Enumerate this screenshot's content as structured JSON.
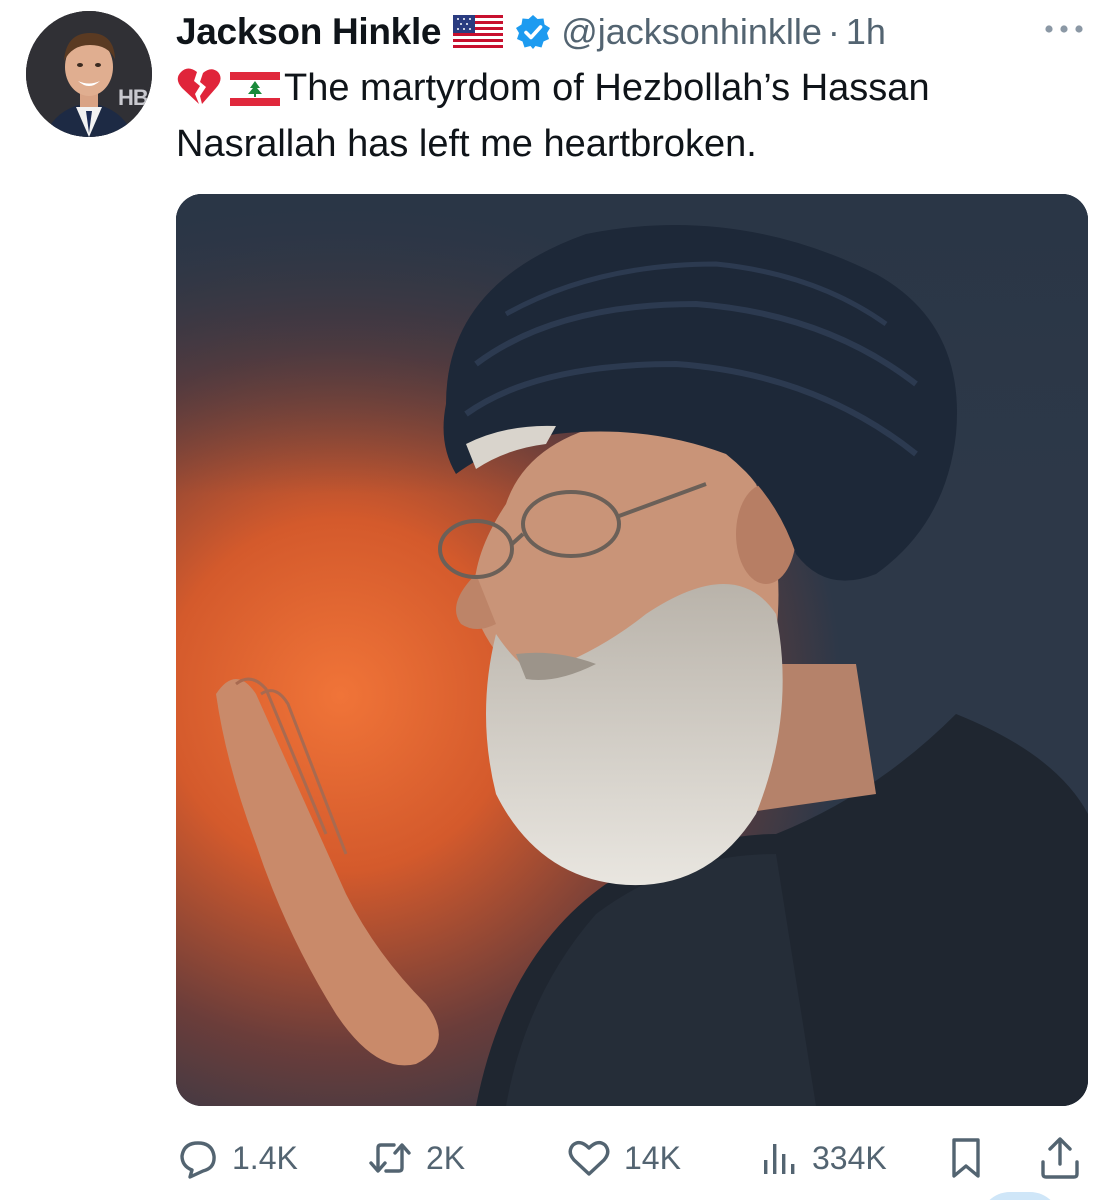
{
  "author": {
    "display_name": "Jackson Hinkle",
    "handle": "@jacksonhinklle",
    "separator": "·",
    "time": "1h",
    "avatar_badge_text": "HB"
  },
  "icons": {
    "name_flag": "us-flag-icon",
    "verified": "verified-badge-icon",
    "more": "more-options-icon",
    "emoji_1": "broken-heart-emoji",
    "emoji_2": "lebanon-flag-emoji",
    "reply": "reply-icon",
    "retweet": "retweet-icon",
    "like": "like-icon",
    "views": "views-icon",
    "bookmark": "bookmark-icon",
    "share": "share-icon"
  },
  "tweet": {
    "text_line_1": "The martyrdom of Hezbollah’s Hassan",
    "text_line_2": "Nasrallah has left me heartbroken."
  },
  "metrics": {
    "replies": "1.4K",
    "retweets": "2K",
    "likes": "14K",
    "views": "334K"
  },
  "colors": {
    "text_primary": "#0f1419",
    "text_secondary": "#536471",
    "verified_blue": "#1d9bf0"
  }
}
